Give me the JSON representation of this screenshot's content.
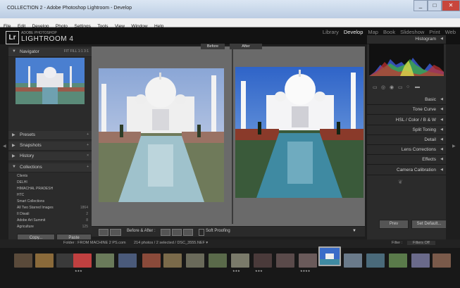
{
  "window": {
    "title": "COLLECTION 2 - Adobe Photoshop Lightroom - Develop",
    "min": "_",
    "max": "□",
    "close": "✕"
  },
  "menu": [
    "File",
    "Edit",
    "Develop",
    "Photo",
    "Settings",
    "Tools",
    "View",
    "Window",
    "Help"
  ],
  "identity": {
    "adobe": "ADOBE PHOTOSHOP",
    "product": "LIGHTROOM 4",
    "logo": "Lr"
  },
  "modules": [
    "Library",
    "Develop",
    "Map",
    "Book",
    "Slideshow",
    "Print",
    "Web"
  ],
  "active_module": "Develop",
  "left": {
    "navigator": {
      "title": "Navigator",
      "zoom": "FIT   FILL   1:1   3:1"
    },
    "panels": [
      "Presets",
      "Snapshots",
      "History",
      "Collections"
    ],
    "collections": [
      {
        "name": "Clients",
        "count": ""
      },
      {
        "name": "DELHI",
        "count": ""
      },
      {
        "name": "HIMACHAL PRADESH",
        "count": ""
      },
      {
        "name": "HTC",
        "count": ""
      },
      {
        "name": "Smart Collections",
        "count": ""
      },
      {
        "name": "All Two Starred Images",
        "count": "1864"
      },
      {
        "name": "II Diwali",
        "count": "2"
      },
      {
        "name": "Adobe Art Summit",
        "count": "8"
      },
      {
        "name": "Agriculture",
        "count": "125"
      }
    ],
    "copy": "Copy...",
    "paste": "Paste"
  },
  "view": {
    "before": "Before",
    "after": "After"
  },
  "toolbar": {
    "before_after": "Before & After :",
    "soft_proof": "Soft Proofing"
  },
  "right": {
    "histogram": "Histogram",
    "panels": [
      "Basic",
      "Tone Curve",
      "HSL  /  Color  /  B & W",
      "Split Toning",
      "Detail",
      "Lens Corrections",
      "Effects",
      "Camera Calibration"
    ],
    "prev": "Prev",
    "reset": "Set Default..."
  },
  "filmstrip": {
    "folder": "Folder : FROM MACHINE 2 PS.com",
    "info": "214 photos / 2 selected / DSC_3555.NEF ▾",
    "filter": "Filter :",
    "filter_value": "Filters Off"
  },
  "colors": {
    "accent": "#dddddd",
    "panel": "#2b2b2b",
    "center": "#6a6a6a"
  }
}
